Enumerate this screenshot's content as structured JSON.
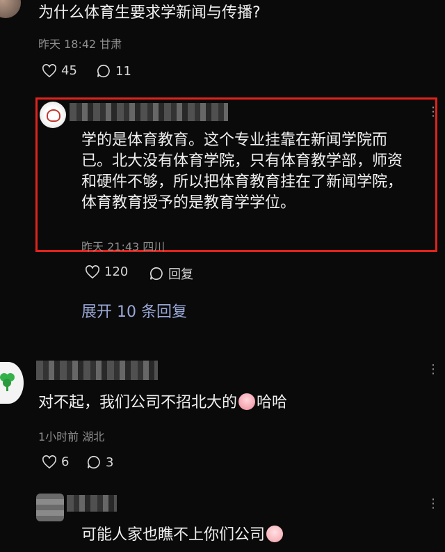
{
  "comment1": {
    "text": "为什么体育生要求学新闻与传播?",
    "time": "昨天 18:42",
    "location": "甘肃",
    "likes": "45",
    "replies": "11"
  },
  "reply1": {
    "text_lines": [
      "学的是体育教育。这个专业挂靠在新闻学院而",
      "已。北大没有体育学院，只有体育教学部，师资",
      "和硬件不够，所以把体育教育挂在了新闻学院，",
      "体育教育授予的是教育学学位。"
    ],
    "time": "昨天 21:43",
    "location": "四川",
    "likes": "120",
    "reply_label": "回复",
    "highlight_color": "#e0231c"
  },
  "expand": {
    "label": "展开 10 条回复",
    "color": "#9aa9d9"
  },
  "comment2": {
    "text_before": "对不起，我们公司不招北大的",
    "text_after": "哈哈",
    "emoji": "crying-emoji",
    "time": "1小时前",
    "location": "湖北",
    "likes": "6",
    "replies": "3"
  },
  "comment3": {
    "text": "可能人家也瞧不上你们公司",
    "emoji": "shocked-emoji"
  }
}
